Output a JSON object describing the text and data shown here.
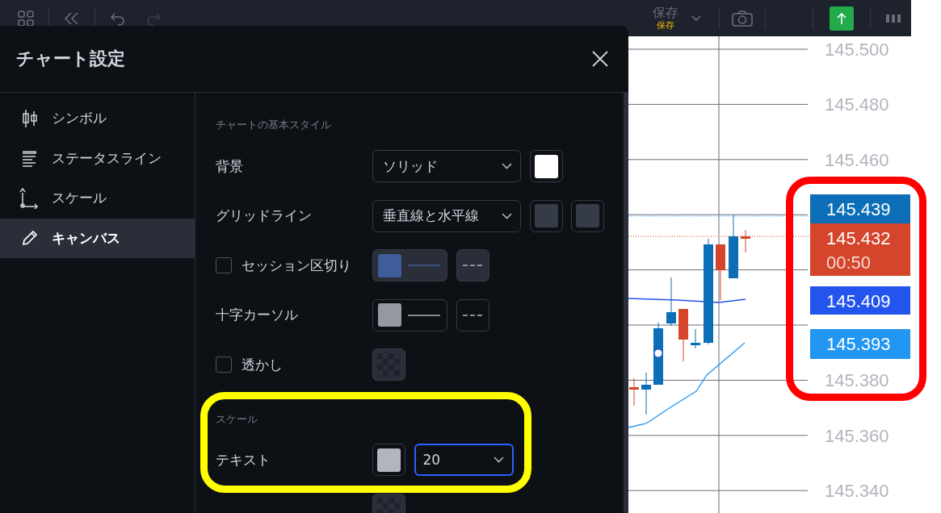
{
  "toolbar": {
    "undo": {
      "disabled": false
    },
    "redo": {
      "disabled": true
    },
    "save": {
      "label": "保存",
      "sublabel": "保存"
    }
  },
  "dialog": {
    "title": "チャート設定",
    "sidebar": [
      {
        "label": "シンボル",
        "selected": false
      },
      {
        "label": "ステータスライン",
        "selected": false
      },
      {
        "label": "スケール",
        "selected": false
      },
      {
        "label": "キャンバス",
        "selected": true
      }
    ],
    "sections": [
      {
        "heading": "チャートの基本スタイル",
        "rows": [
          {
            "label": "背景",
            "controls": [
              {
                "kind": "select",
                "value": "ソリッド",
                "focused": false
              },
              {
                "kind": "swatch",
                "color": "#ffffff"
              }
            ]
          },
          {
            "label": "グリッドライン",
            "controls": [
              {
                "kind": "select",
                "value": "垂直線と水平線",
                "focused": false
              },
              {
                "kind": "swatch",
                "color": "#363c47"
              },
              {
                "kind": "swatch",
                "color": "#363c47"
              }
            ]
          },
          {
            "label": "セッション区切り",
            "checked": false,
            "controls": [
              {
                "kind": "swatch-line",
                "color": "#3f5d99"
              },
              {
                "kind": "dash"
              }
            ]
          },
          {
            "label": "十字カーソル",
            "controls": [
              {
                "kind": "swatch-line",
                "color": "#9598a1"
              },
              {
                "kind": "dash"
              }
            ]
          },
          {
            "label": "透かし",
            "checked": false,
            "controls": [
              {
                "kind": "pattern"
              }
            ]
          }
        ]
      },
      {
        "heading": "スケール",
        "rows": [
          {
            "label": "テキスト",
            "controls": [
              {
                "kind": "swatch",
                "color": "#b2b5be"
              },
              {
                "kind": "select",
                "value": "20",
                "focused": true
              }
            ]
          },
          {
            "controls": [
              {
                "kind": "pattern"
              }
            ]
          }
        ]
      }
    ]
  },
  "price_axis": {
    "labels": [
      "145.500",
      "145.480",
      "145.460",
      "145.380",
      "145.360",
      "145.340"
    ]
  },
  "price_labels": [
    {
      "value": "145.439",
      "color": "#0b6eb6"
    },
    {
      "value": "145.432",
      "countdown": "00:50",
      "color": "#d5452b"
    },
    {
      "value": "145.409",
      "color": "#2354ee"
    },
    {
      "value": "145.393",
      "color": "#2196f3"
    }
  ]
}
